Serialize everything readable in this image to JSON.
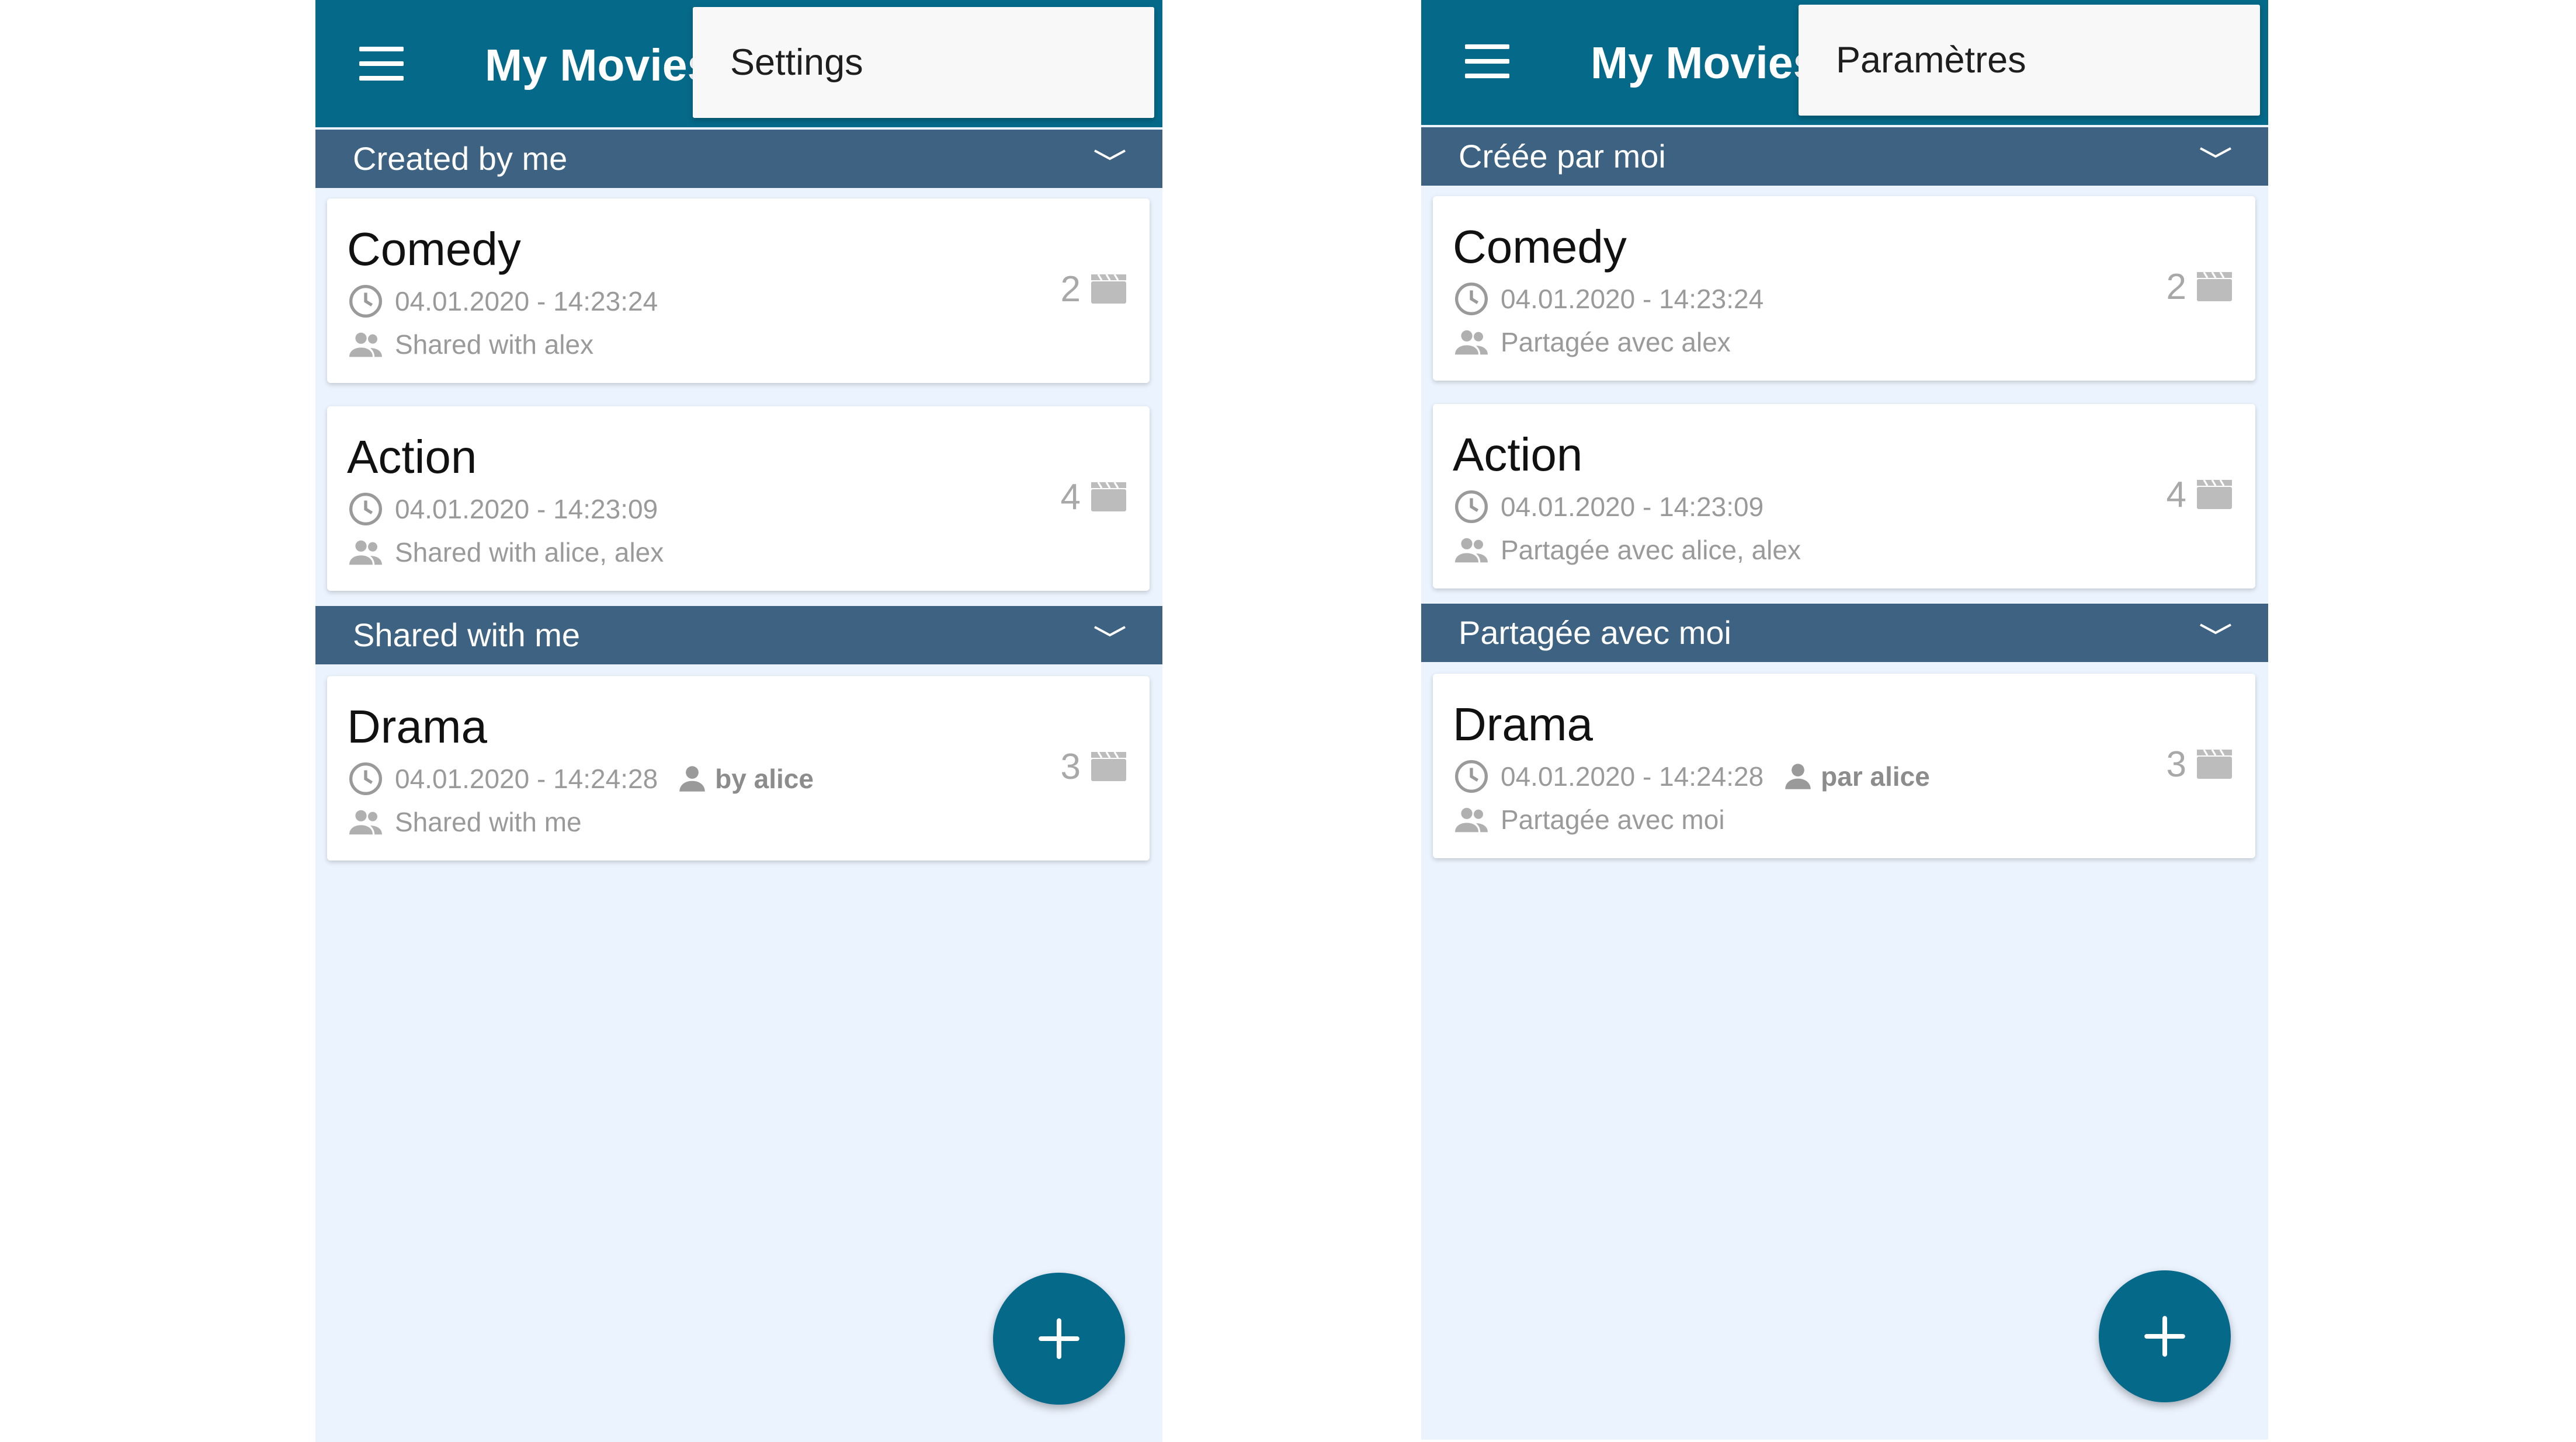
{
  "colors": {
    "primary": "#056a8a",
    "section_header": "#3e6282",
    "background": "#ebf3fe",
    "card": "#ffffff",
    "meta_text": "#9a9a9a"
  },
  "screens": [
    {
      "app_title": "My Movies",
      "menu": {
        "items": [
          {
            "label": "Settings"
          }
        ]
      },
      "sections": [
        {
          "label": "Created by me",
          "lists": [
            {
              "title": "Comedy",
              "date": "04.01.2020 - 14:23:24",
              "shared": "Shared with alex",
              "count": "2"
            },
            {
              "title": "Action",
              "date": "04.01.2020 - 14:23:09",
              "shared": "Shared with alice, alex",
              "count": "4"
            }
          ]
        },
        {
          "label": "Shared with me",
          "lists": [
            {
              "title": "Drama",
              "date": "04.01.2020 - 14:24:28",
              "owner": "by alice",
              "shared": "Shared with me",
              "count": "3"
            }
          ]
        }
      ],
      "fab_icon": "plus-icon"
    },
    {
      "app_title": "My Movies",
      "menu": {
        "items": [
          {
            "label": "Paramètres"
          }
        ]
      },
      "sections": [
        {
          "label": "Créée par moi",
          "lists": [
            {
              "title": "Comedy",
              "date": "04.01.2020 - 14:23:24",
              "shared": "Partagée avec alex",
              "count": "2"
            },
            {
              "title": "Action",
              "date": "04.01.2020 - 14:23:09",
              "shared": "Partagée avec alice, alex",
              "count": "4"
            }
          ]
        },
        {
          "label": "Partagée avec moi",
          "lists": [
            {
              "title": "Drama",
              "date": "04.01.2020 - 14:24:28",
              "owner": "par alice",
              "shared": "Partagée avec moi",
              "count": "3"
            }
          ]
        }
      ],
      "fab_icon": "plus-icon"
    }
  ]
}
